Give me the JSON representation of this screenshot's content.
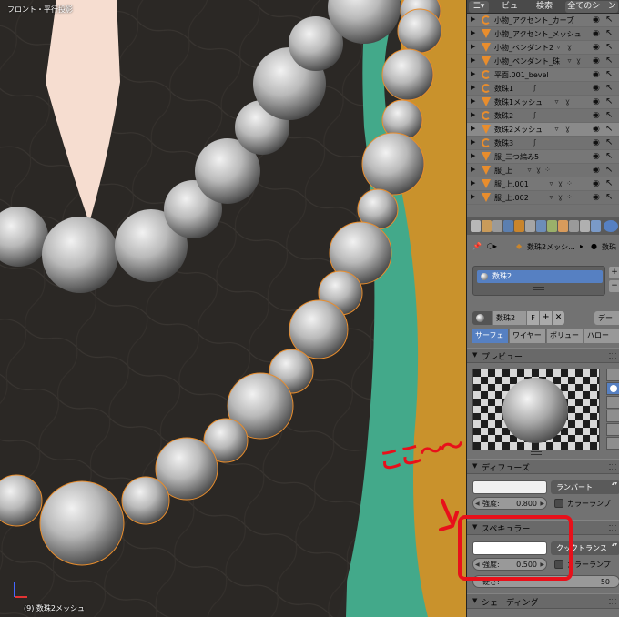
{
  "viewport": {
    "title": "フロント・平行投影",
    "status": "(9) 数珠2メッシュ"
  },
  "outliner_header": {
    "view_menu": "ビュー",
    "search_menu": "検索",
    "scene_select": "全てのシーン"
  },
  "outliner": {
    "rows": [
      {
        "name": "小物_アクセント_カーブ",
        "type": "curve"
      },
      {
        "name": "小物_アクセント_メッシュ",
        "type": "mesh"
      },
      {
        "name": "小物_ペンダント2",
        "type": "mesh"
      },
      {
        "name": "小物_ペンダント_珠",
        "type": "mesh"
      },
      {
        "name": "平面.001_bevel",
        "type": "curve"
      },
      {
        "name": "数珠1",
        "type": "curve"
      },
      {
        "name": "数珠1メッシュ",
        "type": "mesh"
      },
      {
        "name": "数珠2",
        "type": "curve"
      },
      {
        "name": "数珠2メッシュ",
        "type": "mesh"
      },
      {
        "name": "数珠3",
        "type": "curve"
      },
      {
        "name": "服_三つ編み5",
        "type": "mesh"
      },
      {
        "name": "服_上",
        "type": "mesh"
      },
      {
        "name": "服_上.001",
        "type": "mesh"
      },
      {
        "name": "服_上.002",
        "type": "mesh"
      }
    ]
  },
  "breadcrumb": {
    "object": "数珠2メッシ...",
    "material": "数珠"
  },
  "material_slots": {
    "items": [
      "数珠2"
    ],
    "add": "+",
    "remove": "−"
  },
  "material": {
    "name": "数珠2",
    "fake_user": "F",
    "new": "+",
    "unlink": "✕",
    "data_select": "デー"
  },
  "material_tabs": [
    "サーフェ",
    "ワイヤー",
    "ボリュー",
    "ハロー"
  ],
  "panels": {
    "preview": "プレビュー",
    "diffuse": "ディフューズ",
    "specular": "スペキュラー",
    "shading": "シェーディング"
  },
  "diffuse": {
    "color": "#f0f0f0",
    "shader": "ランバート",
    "intensity_label": "強度:",
    "intensity_value": "0.800",
    "ramp_label": "カラーランプ"
  },
  "specular": {
    "color": "#ffffff",
    "shader": "クックトランス",
    "intensity_label": "強度:",
    "intensity_value": "0.500",
    "ramp_label": "カラーランプ",
    "hardness_label": "硬さ:",
    "hardness_value": "50"
  },
  "annotation": {
    "text": "ここ〜〜",
    "color": "#e8101a"
  }
}
